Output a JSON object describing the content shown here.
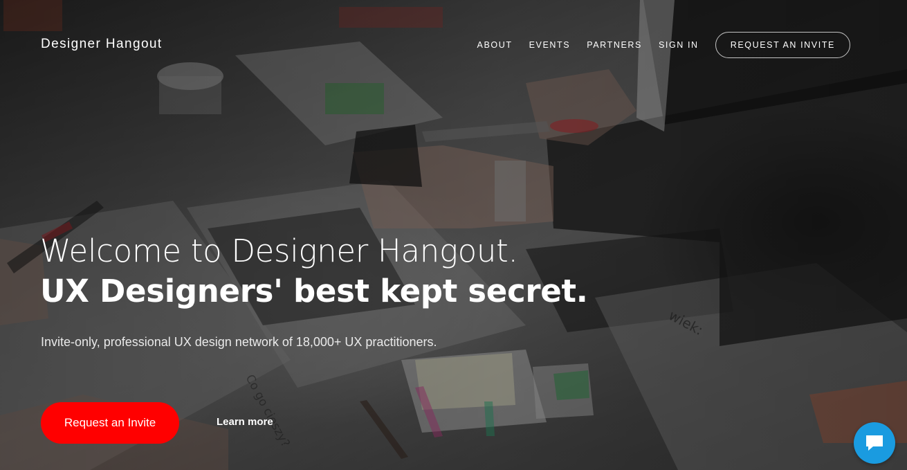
{
  "brand": {
    "name": "Designer Hangout"
  },
  "nav": {
    "links": [
      "ABOUT",
      "EVENTS",
      "PARTNERS",
      "SIGN IN"
    ],
    "cta_label": "REQUEST AN INVITE"
  },
  "hero": {
    "headline_line1": "Welcome to Designer Hangout.",
    "headline_line2": "UX Designers' best kept secret.",
    "subtitle": "Invite-only, professional UX design network of 18,000+ UX practitioners.",
    "primary_button_label": "Request an Invite",
    "secondary_link_label": "Learn more"
  },
  "chat": {
    "icon": "chat-bubble-icon"
  },
  "colors": {
    "primary_button": "#ff0000",
    "chat_widget": "#1a9be0",
    "text": "#ffffff"
  }
}
